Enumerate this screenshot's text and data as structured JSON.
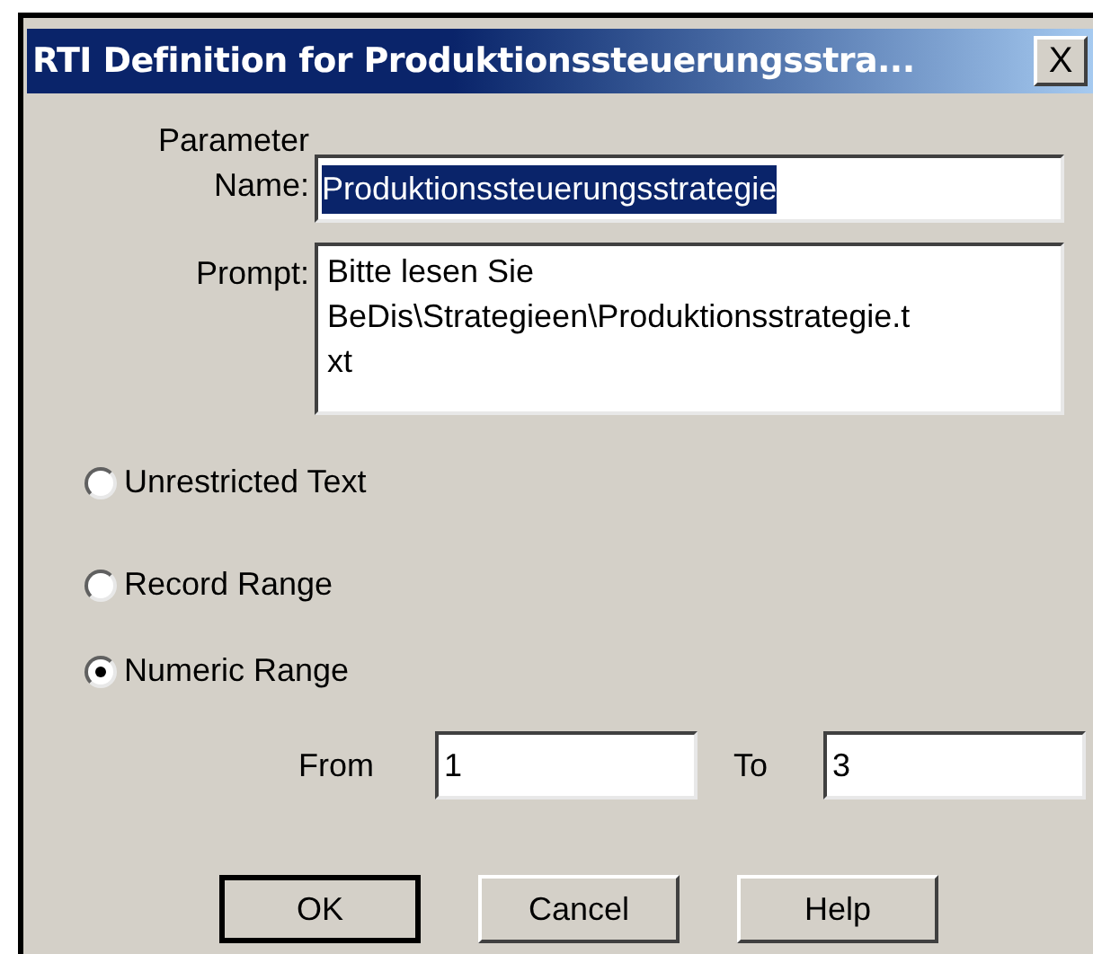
{
  "window": {
    "title": "RTI Definition for Produktionssteuerungsstra...",
    "close": "X"
  },
  "parameter_name": {
    "label_lines": [
      "Parameter",
      "Name:"
    ],
    "value": "Produktionssteuerungsstrategie",
    "selected": true
  },
  "prompt": {
    "label": "Prompt:",
    "lines": [
      "Bitte lesen Sie",
      "BeDis\\Strategieen\\Produktionsstrategie.t",
      "xt"
    ]
  },
  "options": [
    {
      "label": "Unrestricted Text",
      "selected": false
    },
    {
      "label": "Record Range",
      "selected": false
    },
    {
      "label": "Numeric Range",
      "selected": true
    }
  ],
  "range": {
    "from_label": "From",
    "from": "1",
    "to_label": "To",
    "to": "3"
  },
  "buttons": [
    {
      "label": "OK",
      "default": true
    },
    {
      "label": "Cancel",
      "default": false
    },
    {
      "label": "Help",
      "default": false
    }
  ]
}
